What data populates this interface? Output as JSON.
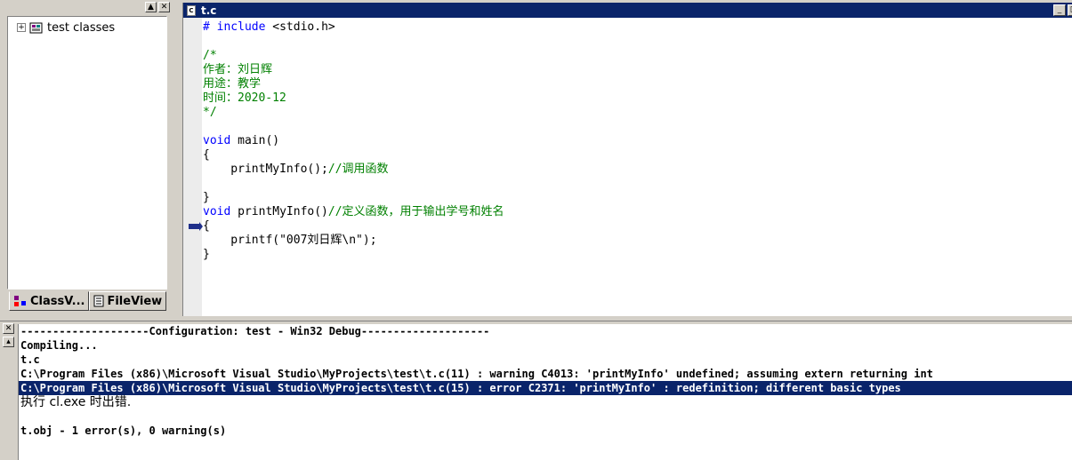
{
  "workspace": {
    "tree_root": "test classes",
    "tabs": [
      {
        "label": "ClassV..."
      },
      {
        "label": "FileView"
      }
    ]
  },
  "editor": {
    "title": "t.c",
    "lines": [
      [
        {
          "t": "# include ",
          "c": "kw"
        },
        {
          "t": "<stdio.h>",
          "c": ""
        }
      ],
      [
        {
          "t": "",
          "c": ""
        }
      ],
      [
        {
          "t": "/*",
          "c": "cm"
        }
      ],
      [
        {
          "t": "作者：刘日辉",
          "c": "cm"
        }
      ],
      [
        {
          "t": "用途：教学",
          "c": "cm"
        }
      ],
      [
        {
          "t": "时间：2020-12",
          "c": "cm"
        }
      ],
      [
        {
          "t": "*/",
          "c": "cm"
        }
      ],
      [
        {
          "t": "",
          "c": ""
        }
      ],
      [
        {
          "t": "void",
          "c": "kw"
        },
        {
          "t": " main()",
          "c": ""
        }
      ],
      [
        {
          "t": "{",
          "c": ""
        }
      ],
      [
        {
          "t": "    printMyInfo();",
          "c": ""
        },
        {
          "t": "//调用函数",
          "c": "cm"
        }
      ],
      [
        {
          "t": "",
          "c": ""
        }
      ],
      [
        {
          "t": "}",
          "c": ""
        }
      ],
      [
        {
          "t": "void",
          "c": "kw"
        },
        {
          "t": " printMyInfo()",
          "c": ""
        },
        {
          "t": "//定义函数，用于输出学号和姓名",
          "c": "cm"
        }
      ],
      [
        {
          "t": "{",
          "c": ""
        }
      ],
      [
        {
          "t": "    printf(\"007刘日辉\\n\");",
          "c": ""
        }
      ],
      [
        {
          "t": "}",
          "c": ""
        }
      ]
    ]
  },
  "output": {
    "lines": [
      {
        "text": "--------------------Configuration: test - Win32 Debug--------------------",
        "selected": false,
        "cjk": false
      },
      {
        "text": "Compiling...",
        "selected": false,
        "cjk": false
      },
      {
        "text": "t.c",
        "selected": false,
        "cjk": false
      },
      {
        "text": "C:\\Program Files (x86)\\Microsoft Visual Studio\\MyProjects\\test\\t.c(11) : warning C4013: 'printMyInfo' undefined; assuming extern returning int",
        "selected": false,
        "cjk": false
      },
      {
        "text": "C:\\Program Files (x86)\\Microsoft Visual Studio\\MyProjects\\test\\t.c(15) : error C2371: 'printMyInfo' : redefinition; different basic types",
        "selected": true,
        "cjk": false
      },
      {
        "text": "执行 cl.exe 时出错.",
        "selected": false,
        "cjk": true
      },
      {
        "text": "",
        "selected": false,
        "cjk": false
      },
      {
        "text": "t.obj - 1 error(s), 0 warning(s)",
        "selected": false,
        "cjk": false
      }
    ]
  }
}
